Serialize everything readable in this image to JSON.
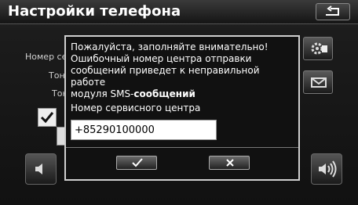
{
  "header": {
    "title": "Настройки телефона"
  },
  "background": {
    "row1_label": "Номер се",
    "row2_label": "Тон",
    "row3_label": "Тон"
  },
  "dialog": {
    "message_line1": "Пожалуйста, заполняйте внимательно!",
    "message_line2": "Ошибочный номер центра отправки",
    "message_line3": "сообщений приведет к неправильной работе",
    "message_line4_prefix": "модуля SMS-",
    "message_line4_bold": "сообщений",
    "field_label": "Номер сервисного центра",
    "field_value": "+85290100000"
  },
  "colors": {
    "background": "#111111",
    "dialog_border": "#cfcfcf",
    "text": "#ffffff"
  },
  "icons": [
    "back-arrow-icon",
    "gear-settings-icon",
    "message-settings-icon",
    "volume-down-icon",
    "volume-up-icon",
    "check-icon",
    "cross-icon"
  ]
}
